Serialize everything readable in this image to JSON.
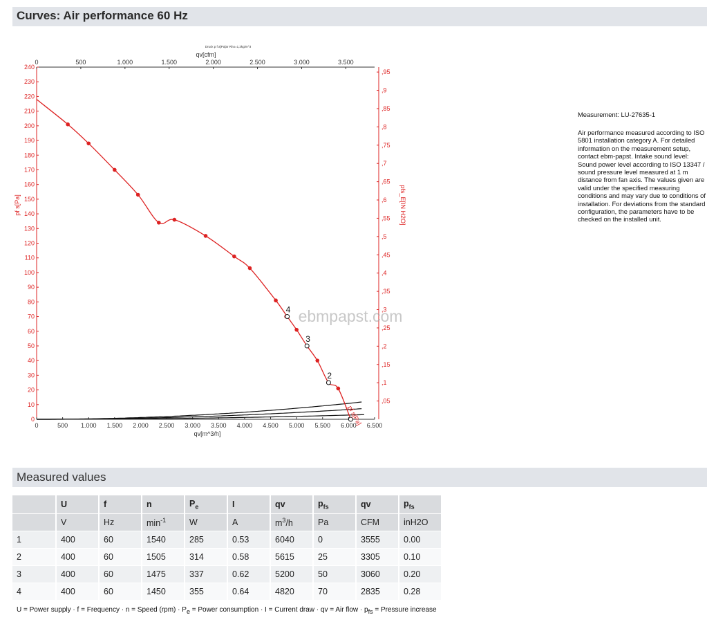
{
  "header": {
    "title": "Curves: Air performance 60 Hz"
  },
  "chart_data": {
    "type": "line",
    "tiny_header": "Druck p f a[Pa]ar Rho=1,2kg/m^3",
    "x_axis": {
      "label": "qv[m^3/h]",
      "range": [
        0,
        6500
      ],
      "ticks": [
        0,
        500,
        1000,
        1500,
        2000,
        2500,
        3000,
        3500,
        4000,
        4500,
        5000,
        5500,
        6000,
        6500
      ],
      "tick_labels": [
        "0",
        "500",
        "1.000",
        "1.500",
        "2.000",
        "2.500",
        "3.000",
        "3.500",
        "4.000",
        "4.500",
        "5.000",
        "5.500",
        "6.000",
        "6.500"
      ]
    },
    "x2_axis": {
      "label": "qv[cfm]",
      "range": [
        0,
        3825.7
      ],
      "ticks": [
        0,
        500,
        1000,
        1500,
        2000,
        2500,
        3000,
        3500
      ],
      "tick_labels": [
        "0",
        "500",
        "1.000",
        "1.500",
        "2.000",
        "2.500",
        "3.000",
        "3.500"
      ]
    },
    "y_axis": {
      "label": "pf s[Pa]",
      "range": [
        0,
        240
      ],
      "ticks": [
        0,
        10,
        20,
        30,
        40,
        50,
        60,
        70,
        80,
        90,
        100,
        110,
        120,
        130,
        140,
        150,
        160,
        170,
        180,
        190,
        200,
        210,
        220,
        230,
        240
      ]
    },
    "y2_axis": {
      "label": "pfs_E[IN H2O]",
      "range": [
        0,
        0.9635
      ],
      "ticks": [
        0.05,
        0.1,
        0.15,
        0.2,
        0.25,
        0.3,
        0.35,
        0.4,
        0.45,
        0.5,
        0.55,
        0.6,
        0.65,
        0.7,
        0.75,
        0.8,
        0.85,
        0.9,
        0.95
      ],
      "tick_labels": [
        ",05",
        ",1",
        ",15",
        ",2",
        ",25",
        ",3",
        ",35",
        ",4",
        ",45",
        ",5",
        ",55",
        ",6",
        ",65",
        ",7",
        ",75",
        ",8",
        ",85",
        ",9",
        ",95"
      ]
    },
    "watermark": "ebmpapst.com",
    "fan_curve": {
      "name": "pf s[Pa]",
      "color": "#dd2222",
      "points": [
        [
          0,
          218
        ],
        [
          600,
          201
        ],
        [
          1000,
          188
        ],
        [
          1500,
          170
        ],
        [
          1950,
          153
        ],
        [
          2350,
          134
        ],
        [
          2650,
          136
        ],
        [
          3250,
          125
        ],
        [
          3800,
          111
        ],
        [
          4100,
          103
        ],
        [
          4600,
          81
        ],
        [
          4820,
          70
        ],
        [
          5000,
          61
        ],
        [
          5200,
          50
        ],
        [
          5400,
          40
        ],
        [
          5615,
          25
        ],
        [
          5800,
          21
        ],
        [
          6040,
          0
        ]
      ],
      "markers": [
        [
          600,
          201
        ],
        [
          1000,
          188
        ],
        [
          1500,
          170
        ],
        [
          1950,
          153
        ],
        [
          2350,
          134
        ],
        [
          2650,
          136
        ],
        [
          3250,
          125
        ],
        [
          3800,
          111
        ],
        [
          4100,
          103
        ],
        [
          4600,
          81
        ],
        [
          4800,
          70
        ],
        [
          5000,
          61
        ],
        [
          5400,
          40
        ],
        [
          5800,
          21
        ]
      ]
    },
    "system_curves": [
      {
        "label": "4",
        "k": 0.003013,
        "x_max": 6250,
        "label_at": [
          4820,
          70
        ]
      },
      {
        "label": "3",
        "k": 0.001849,
        "x_max": 6250,
        "label_at": [
          5200,
          50
        ]
      },
      {
        "label": "2",
        "k": 0.000793,
        "x_max": 6300,
        "label_at": [
          5615,
          25
        ]
      }
    ],
    "operating_points": [
      [
        4820,
        70
      ],
      [
        5200,
        50
      ],
      [
        5615,
        25
      ],
      [
        6040,
        0
      ]
    ]
  },
  "notes": {
    "measurement_id": "Measurement: LU-27635-1",
    "description": "Air performance measured according to ISO 5801 installation category A. For detailed information on the measurement setup, contact ebm-papst. Intake sound level: Sound power level according to ISO 13347 / sound pressure level measured at 1 m distance from fan axis. The values given are valid under the specified measuring conditions and may vary due to conditions of installation. For deviations from the standard configuration, the parameters have to be checked on the installed unit."
  },
  "measured": {
    "title": "Measured values",
    "headers": [
      "U",
      "f",
      "n",
      "P",
      "I",
      "qv",
      "p",
      "qv",
      "p"
    ],
    "header_subs": [
      "",
      "",
      "",
      "e",
      "",
      "",
      "fs",
      "",
      "fs"
    ],
    "units": [
      "V",
      "Hz",
      "min",
      "W",
      "A",
      "m",
      "Pa",
      "CFM",
      "inH2O"
    ],
    "unit_sup": [
      "",
      "",
      "-1",
      "",
      "",
      "3",
      "",
      "",
      ""
    ],
    "unit_tail": [
      "",
      "",
      "",
      "",
      "",
      "/h",
      "",
      "",
      ""
    ],
    "rows": [
      [
        "1",
        "400",
        "60",
        "1540",
        "285",
        "0.53",
        "6040",
        "0",
        "3555",
        "0.00"
      ],
      [
        "2",
        "400",
        "60",
        "1505",
        "314",
        "0.58",
        "5615",
        "25",
        "3305",
        "0.10"
      ],
      [
        "3",
        "400",
        "60",
        "1475",
        "337",
        "0.62",
        "5200",
        "50",
        "3060",
        "0.20"
      ],
      [
        "4",
        "400",
        "60",
        "1450",
        "355",
        "0.64",
        "4820",
        "70",
        "2835",
        "0.28"
      ]
    ],
    "legend": {
      "a": "U = Power supply · f = Frequency · n = Speed (rpm) · P",
      "a_sub": "e",
      "b": " = Power consumption · I = Current draw · qv = Air flow · p",
      "b_sub": "fs",
      "c": " = Pressure increase"
    }
  }
}
